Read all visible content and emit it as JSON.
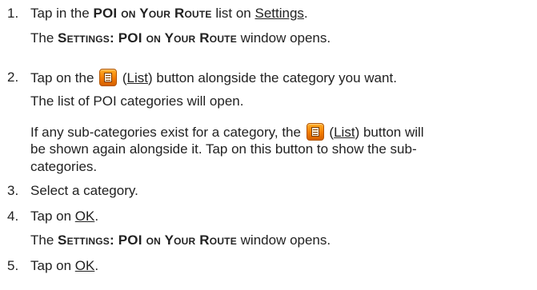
{
  "steps": [
    {
      "num": "1.",
      "pre": "Tap in the ",
      "bold": "POI on Your Route",
      "mid": " list on ",
      "link": "Settings",
      "post": "."
    },
    {
      "result_label": "Settings: POI on Your Route",
      "result_post": " window opens.",
      "result_pre": "The "
    },
    {
      "num": "2.",
      "pre": "Tap on the ",
      "link": "List",
      "post": " button alongside the category you want."
    },
    {
      "text": "The list of POI categories will open."
    },
    {
      "pre": "If any sub-categories exist for a category, the ",
      "link": "List",
      "post": " button will"
    },
    {
      "text": "be shown again alongside it. Tap on this button to show the sub-"
    },
    {
      "text": "categories."
    },
    {
      "num": "3.",
      "text": "Select a category."
    },
    {
      "num": "4.",
      "pre": "Tap on ",
      "link": "OK",
      "post": "."
    },
    {
      "result_pre": "The ",
      "result_label": "Settings: POI on Your Route",
      "result_post": " window opens."
    },
    {
      "num": "5.",
      "pre": "Tap on ",
      "link": "OK",
      "post": "."
    }
  ],
  "icons": {
    "list_button": "list-icon"
  },
  "colors": {
    "text": "#222222",
    "button_orange": "#f27b00"
  }
}
